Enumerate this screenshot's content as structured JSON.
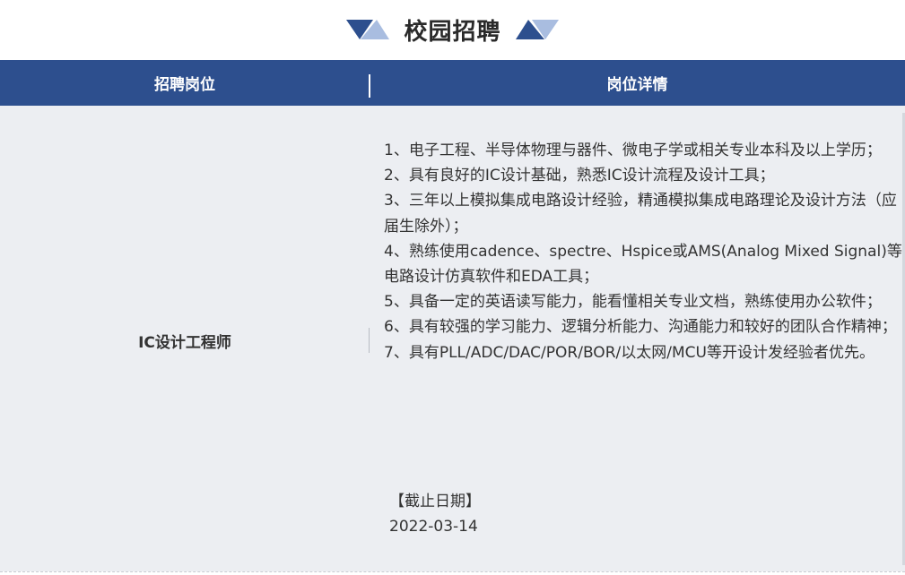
{
  "section": {
    "title": "校园招聘"
  },
  "table": {
    "headers": [
      "招聘岗位",
      "岗位详情"
    ],
    "rows": [
      {
        "position": "IC设计工程师",
        "requirements": [
          "1、电子工程、半导体物理与器件、微电子学或相关专业本科及以上学历；",
          "2、具有良好的IC设计基础，熟悉IC设计流程及设计工具；",
          "3、三年以上模拟集成电路设计经验，精通模拟集成电路理论及设计方法（应届生除外）；",
          "4、熟练使用cadence、spectre、Hspice或AMS(Analog Mixed Signal)等电路设计仿真软件和EDA工具；",
          "5、具备一定的英语读写能力，能看懂相关专业文档，熟练使用办公软件；",
          "6、具有较强的学习能力、逻辑分析能力、沟通能力和较好的团队合作精神；",
          "7、具有PLL/ADC/DAC/POR/BOR/以太网/MCU等开设计发经验者优先。"
        ],
        "deadline_label": "【截止日期】",
        "deadline_date": "2022-03-14"
      }
    ]
  },
  "colors": {
    "header_bg": "#2d4f8e",
    "row_bg": "#eceef2",
    "triangle_dark": "#2d4f8e",
    "triangle_light": "#a9bde0"
  }
}
